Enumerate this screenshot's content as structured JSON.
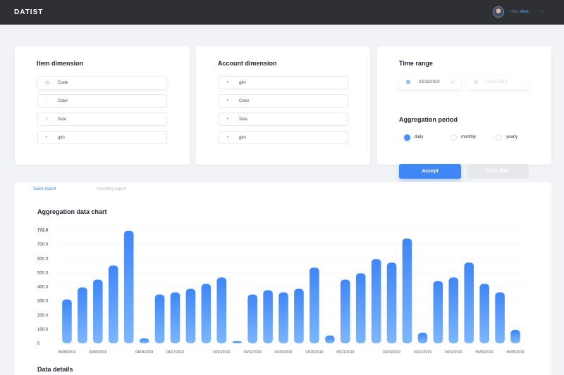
{
  "header": {
    "logo": "DATIST",
    "greeting": "Hello,",
    "user_name": "Mark",
    "caret": "⌄"
  },
  "item_dimension": {
    "title": "Item dimension",
    "fields": [
      {
        "label": "Code",
        "icon": "barcode-icon"
      },
      {
        "label": "Color",
        "icon": "palette-icon"
      },
      {
        "label": "Size",
        "icon": "ruler-icon"
      },
      {
        "label": "gtin",
        "icon": "tag-icon"
      }
    ]
  },
  "account_dimension": {
    "title": "Account dimension",
    "fields": [
      {
        "label": "gtin",
        "icon": "tag-icon"
      },
      {
        "label": "Color",
        "icon": "palette-icon"
      },
      {
        "label": "Size",
        "icon": "ruler-icon"
      },
      {
        "label": "gtin",
        "icon": "tag-icon"
      }
    ]
  },
  "time_range": {
    "title": "Time range",
    "start_date": "03/11/2019",
    "end_date": "03/11/2019",
    "aggregation_title": "Aggregation period",
    "options": [
      "daily",
      "monthly",
      "yearly"
    ],
    "selected": "daily"
  },
  "buttons": {
    "accept": "Accept",
    "clear": "Clear filter"
  },
  "tabs": {
    "sales": "Sales report",
    "inventory": "Inventory report"
  },
  "chart_title": "Aggregation data chart",
  "details_title": "Data details",
  "colors": {
    "accent": "#3f86f7",
    "bar_top": "#3f86f7",
    "bar_bottom": "#7cb6ff",
    "topbar": "#2e3033"
  },
  "chart_data": {
    "type": "bar",
    "title": "Aggregation data chart",
    "xlabel": "",
    "ylabel": "",
    "ylim": [
      0,
      800
    ],
    "y_ticks": [
      "0",
      "100.0",
      "200.0",
      "300.0",
      "400.0",
      "500.0",
      "600.0",
      "700.0",
      "772.0"
    ],
    "y_tick_values": [
      0,
      100,
      200,
      300,
      400,
      500,
      600,
      700,
      800
    ],
    "grid": true,
    "values": [
      310,
      395,
      450,
      550,
      795,
      35,
      345,
      360,
      385,
      420,
      465,
      15,
      345,
      375,
      360,
      385,
      535,
      55,
      450,
      495,
      595,
      570,
      740,
      75,
      440,
      465,
      570,
      420,
      360,
      95
    ],
    "x_tick_labels": [
      {
        "index": 0,
        "label": "05/08/2019"
      },
      {
        "index": 2,
        "label": "03/09/2019"
      },
      {
        "index": 5,
        "label": "04/04/2019"
      },
      {
        "index": 7,
        "label": "04/27/2019"
      },
      {
        "index": 10,
        "label": "04/21/2019"
      },
      {
        "index": 12,
        "label": "04/22/2019"
      },
      {
        "index": 14,
        "label": "04/26/2019"
      },
      {
        "index": 16,
        "label": "04/26/2019"
      },
      {
        "index": 18,
        "label": "05/21/2019"
      },
      {
        "index": 21,
        "label": "03/26/2019"
      },
      {
        "index": 23,
        "label": "04/21/2019"
      },
      {
        "index": 25,
        "label": "04/16/2019"
      },
      {
        "index": 27,
        "label": "05/09/2019"
      },
      {
        "index": 29,
        "label": "05/05/2019"
      }
    ]
  }
}
